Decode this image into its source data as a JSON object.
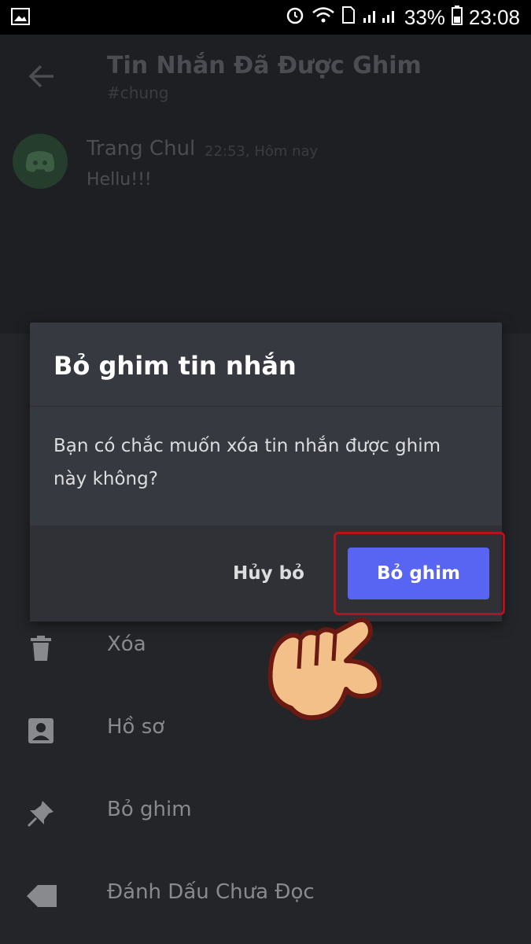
{
  "status_bar": {
    "battery": "33%",
    "time": "23:08"
  },
  "header": {
    "title": "Tin Nhắn Đã Được Ghim",
    "channel": "#chung"
  },
  "pinned_message": {
    "author": "Trang Chul",
    "timestamp": "22:53, Hôm nay",
    "text": "Hellu!!!"
  },
  "sheet_items": [
    {
      "label": "Xóa",
      "icon": "trash-icon"
    },
    {
      "label": "Hồ sơ",
      "icon": "profile-icon"
    },
    {
      "label": "Bỏ ghim",
      "icon": "pin-icon"
    },
    {
      "label": "Đánh Dấu Chưa Đọc",
      "icon": "unread-tag-icon"
    }
  ],
  "dialog": {
    "title": "Bỏ ghim tin nhắn",
    "body": "Bạn có chắc muốn xóa tin nhắn được ghim này không?",
    "cancel_label": "Hủy bỏ",
    "confirm_label": "Bỏ ghim"
  },
  "colors": {
    "accent": "#5865f2",
    "highlight": "#b5121b"
  }
}
